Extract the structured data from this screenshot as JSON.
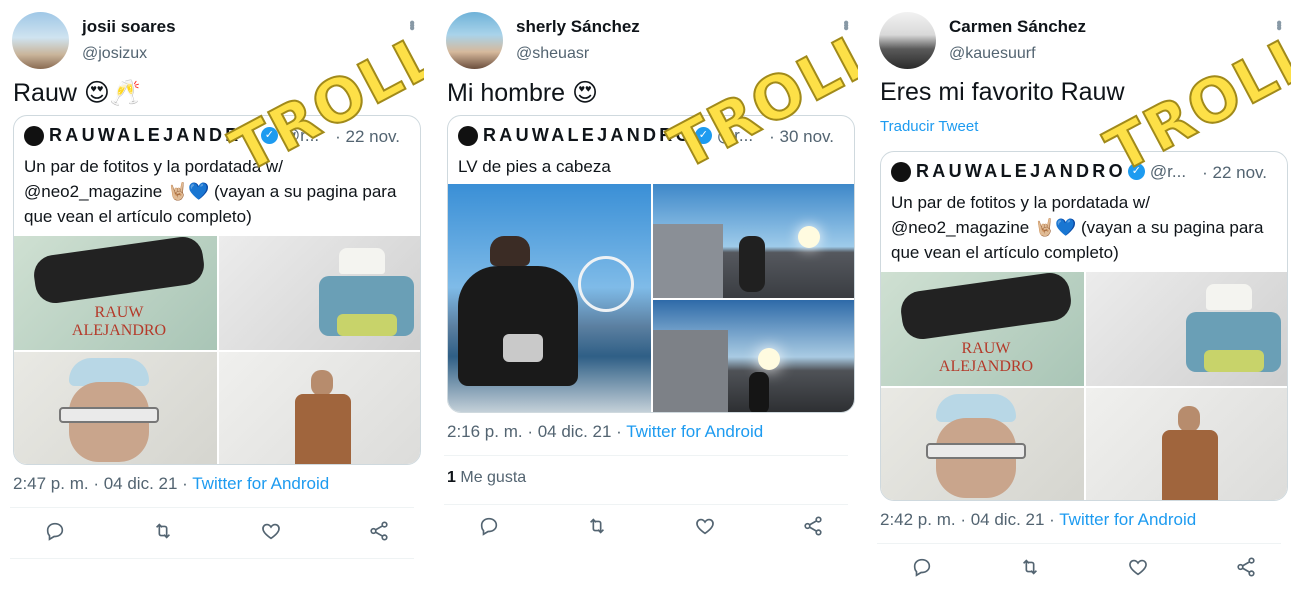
{
  "watermark": "TROLL",
  "panels": [
    {
      "user": {
        "name": "josii soares",
        "handle": "@josizux"
      },
      "text": "Rauw 😍🥂",
      "quote": {
        "author": "RAUWALEJANDRO",
        "handle_trunc": "@r...",
        "date": "· 22 nov.",
        "text": "Un par de fotitos y la pordatada w/ @neo2_magazine 🤘🏼💙 (vayan a su pagina para que vean el artículo completo)",
        "images": [
          "cover-image",
          "photo-bucket-hat",
          "photo-sunglasses",
          "photo-coat"
        ],
        "cover_text": "RAUW ALEJANDRO"
      },
      "time": "2:47 p. m. · 04 dic. 21 ·",
      "source": "Twitter for Android"
    },
    {
      "user": {
        "name": "sherly Sánchez",
        "handle": "@sheuasr"
      },
      "text": "Mi hombre 😍",
      "quote": {
        "author": "RAUWALEJANDRO",
        "handle_trunc": "@r...",
        "date": "· 30 nov.",
        "text": "LV de pies a cabeza",
        "images": [
          "photo-ferris-wheel",
          "photo-rooftop",
          "photo-sunset"
        ]
      },
      "time": "2:16 p. m. · 04 dic. 21 ·",
      "source": "Twitter for Android",
      "likes": {
        "count": "1",
        "label": "Me gusta"
      }
    },
    {
      "user": {
        "name": "Carmen Sánchez",
        "handle": "@kauesuurf"
      },
      "text": "Eres mi favorito Rauw",
      "translate": "Traducir Tweet",
      "quote": {
        "author": "RAUWALEJANDRO",
        "handle_trunc": "@r...",
        "date": "· 22 nov.",
        "text": "Un par de fotitos y la pordatada w/ @neo2_magazine 🤘🏼💙 (vayan a su pagina para que vean el artículo completo)",
        "images": [
          "cover-image",
          "photo-bucket-hat",
          "photo-sunglasses",
          "photo-coat"
        ],
        "cover_text": "RAUW ALEJANDRO"
      },
      "time": "2:42 p. m. · 04 dic. 21 ·",
      "source": "Twitter for Android"
    }
  ],
  "actions": [
    "reply-icon",
    "retweet-icon",
    "like-icon",
    "share-icon"
  ],
  "colors": {
    "link": "#1d9bf0",
    "muted": "#536471",
    "border": "#cfd9de",
    "watermark": "#fde047"
  }
}
